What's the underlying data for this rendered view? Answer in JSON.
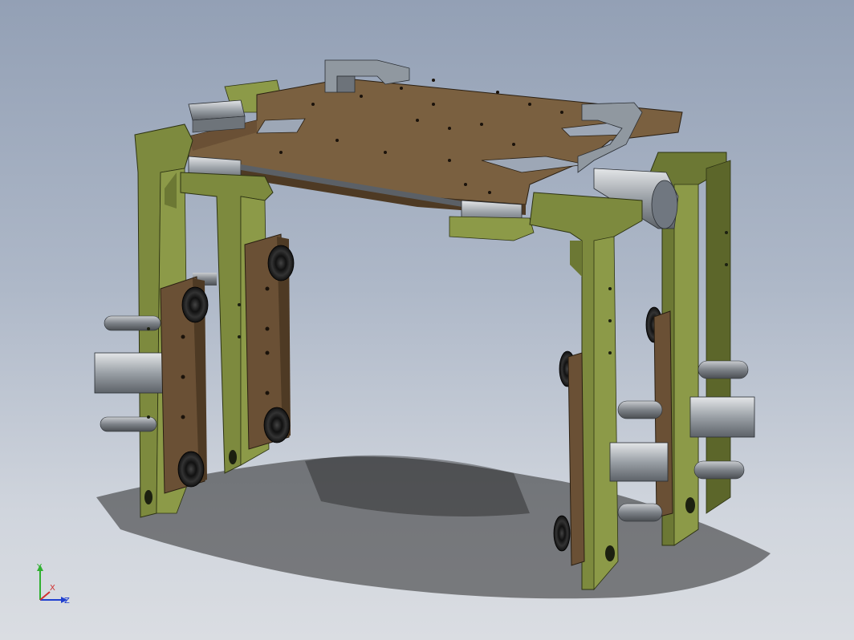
{
  "view": {
    "background_top": "#93a0b5",
    "background_bottom": "#dadde2"
  },
  "model": {
    "frame_color": "#7d8a3e",
    "plate_color": "#7a6040",
    "rail_color": "#9aa0a6"
  },
  "triad": {
    "x_label": "X",
    "y_label": "Y",
    "z_label": "Z",
    "x_color": "#d03030",
    "y_color": "#30b030",
    "z_color": "#2040d0"
  }
}
